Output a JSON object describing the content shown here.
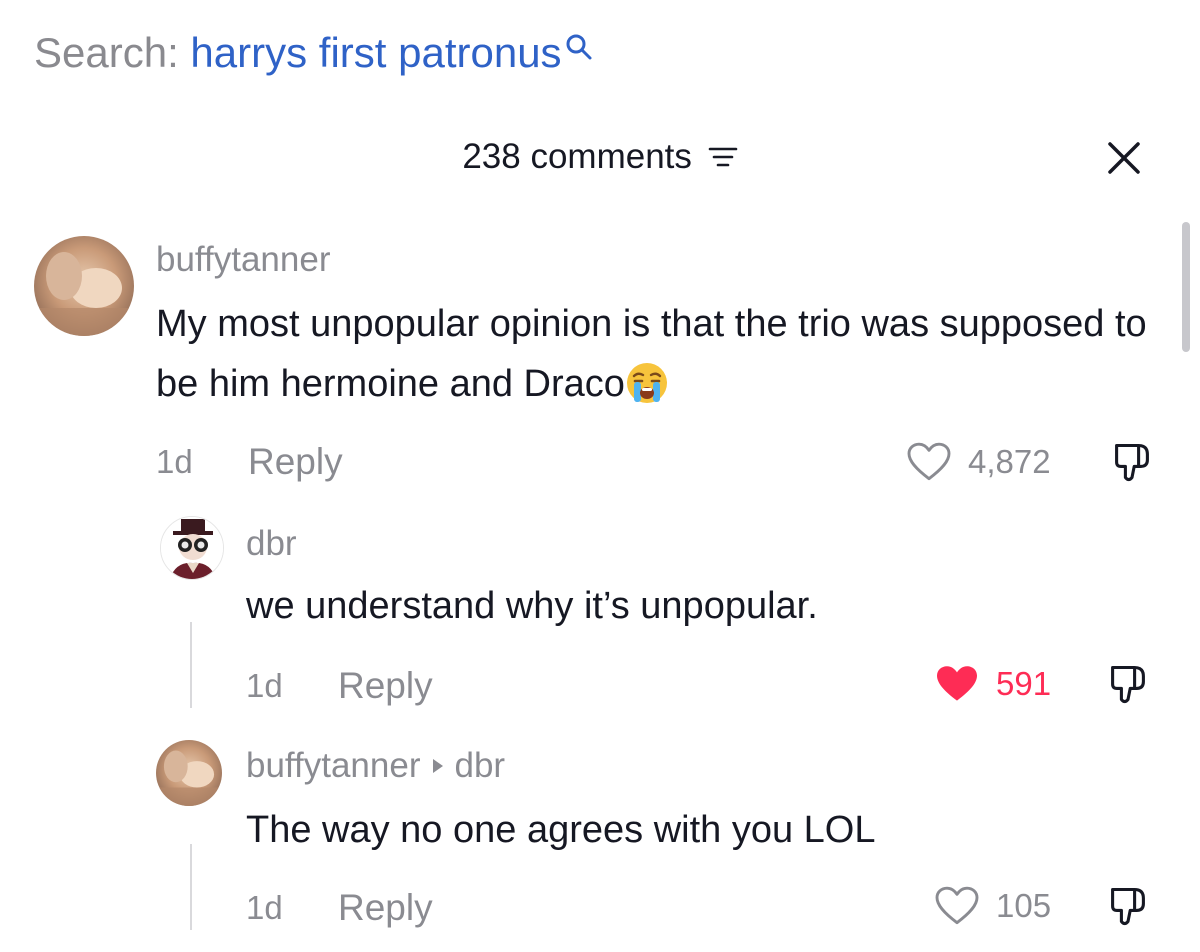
{
  "search": {
    "prefix": "Search:",
    "query": "harrys first patronus",
    "icon": "search-icon"
  },
  "header": {
    "title": "238 comments",
    "filter_icon": "filter-icon",
    "close_icon": "close-icon"
  },
  "comments": [
    {
      "username": "buffytanner",
      "text": "My most unpopular opinion is that the trio was supposed to be him hermoine and Draco",
      "emoji": "loudly-crying-face-emoji",
      "time": "1d",
      "reply_label": "Reply",
      "likes": "4,872",
      "liked": false
    },
    {
      "username": "dbr",
      "text": "we understand why it’s unpopular.",
      "time": "1d",
      "reply_label": "Reply",
      "likes": "591",
      "liked": true
    },
    {
      "username": "buffytanner",
      "reply_to": "dbr",
      "text": "The way no one agrees with you LOL",
      "time": "1d",
      "reply_label": "Reply",
      "likes": "105",
      "liked": false
    }
  ],
  "colors": {
    "accent_link": "#2f62c7",
    "liked_red": "#fe2c55",
    "muted_text": "#8a8b91",
    "primary_text": "#161823"
  }
}
